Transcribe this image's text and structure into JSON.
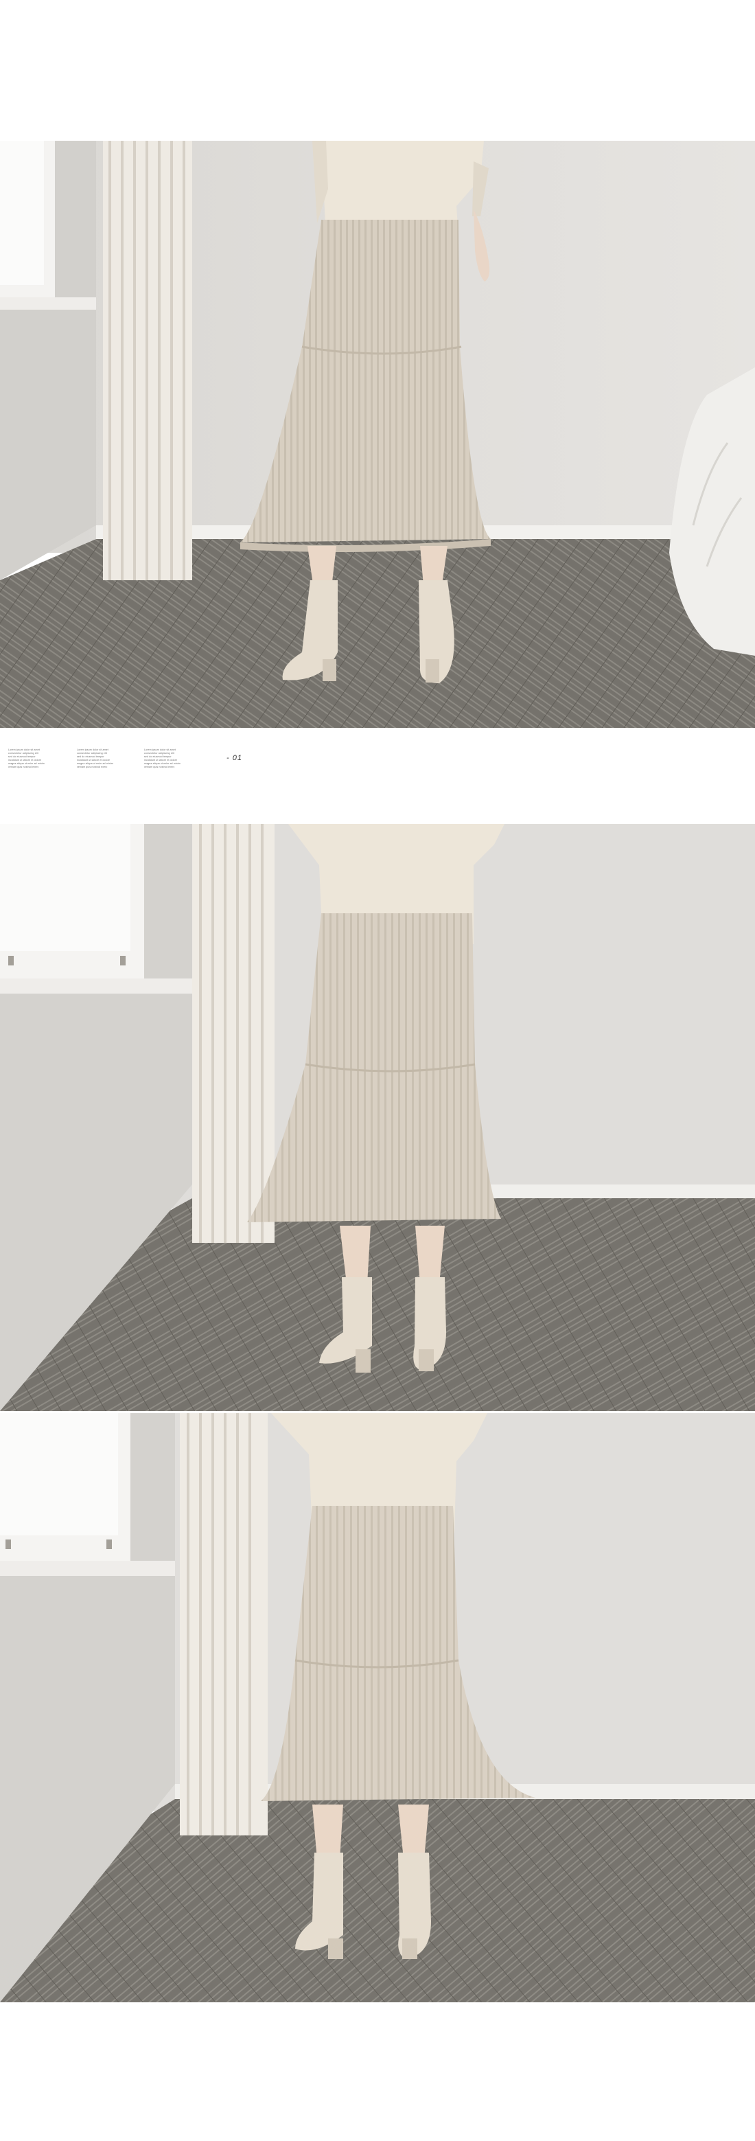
{
  "caption": {
    "columns": [
      [
        "Lorem ipsum dolor sit amet",
        "consectetur adipiscing elit",
        "sed do eiusmod tempor",
        "incididunt ut labore et dolore",
        "magna aliqua ut enim ad minim",
        "veniam quis nostrud exerc"
      ],
      [
        "Lorem ipsum dolor sit amet",
        "consectetur adipiscing elit",
        "sed do eiusmod tempor",
        "incididunt ut labore et dolore",
        "magna aliqua ut enim ad minim",
        "veniam quis nostrud exerc"
      ],
      [
        "Lorem ipsum dolor sit amet",
        "consectetur adipiscing elit",
        "sed do eiusmod tempor",
        "incididunt ut labore et dolore",
        "magna aliqua ut enim ad minim",
        "veniam quis nostrud exerc"
      ]
    ],
    "page_number": "- 01"
  },
  "colors": {
    "wall": "#e3e1de",
    "carpet": "#7a7771",
    "knit": "#d6cdbf",
    "sweater": "#ece5d8",
    "boots": "#e4dccf",
    "curtain": "#f1ede6"
  }
}
